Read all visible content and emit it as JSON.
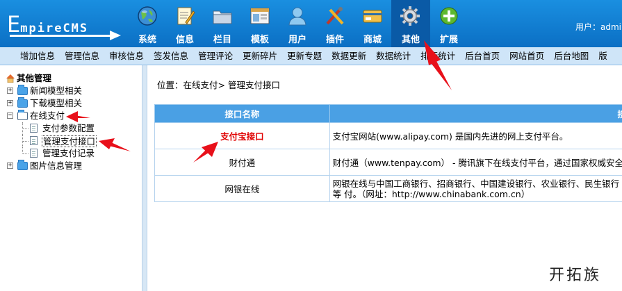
{
  "logo": {
    "first_letter": "E",
    "rest": "mpireCMS"
  },
  "nav": [
    {
      "label": "系统",
      "icon": "globe-icon"
    },
    {
      "label": "信息",
      "icon": "notepad-icon"
    },
    {
      "label": "栏目",
      "icon": "folder-icon"
    },
    {
      "label": "模板",
      "icon": "template-window-icon"
    },
    {
      "label": "用户",
      "icon": "user-icon"
    },
    {
      "label": "插件",
      "icon": "plugin-tools-icon"
    },
    {
      "label": "商城",
      "icon": "shop-card-icon"
    },
    {
      "label": "其他",
      "icon": "gear-icon",
      "active": true
    },
    {
      "label": "扩展",
      "icon": "plus-icon"
    }
  ],
  "user": {
    "label": "用户：",
    "name": "admin"
  },
  "submenu": [
    "增加信息",
    "管理信息",
    "审核信息",
    "签发信息",
    "管理评论",
    "更新碎片",
    "更新专题",
    "数据更新",
    "数据统计",
    "排行统计",
    "后台首页",
    "网站首页",
    "后台地图",
    "版"
  ],
  "tree": {
    "root": "其他管理",
    "nodes": [
      {
        "label": "新闻模型相关",
        "expand": "+"
      },
      {
        "label": "下载模型相关",
        "expand": "+"
      },
      {
        "label": "在线支付",
        "expand": "−",
        "children": [
          "支付参数配置",
          "管理支付接口",
          "管理支付记录"
        ]
      },
      {
        "label": "图片信息管理",
        "expand": "+"
      }
    ]
  },
  "breadcrumb": {
    "prefix": "位置：",
    "parent": "在线支付",
    "sep": "> ",
    "current": "管理支付接口"
  },
  "table": {
    "headers": [
      "接口名称",
      "接"
    ],
    "rows": [
      {
        "name": "支付宝接口",
        "desc": "支付宝网站(www.alipay.com) 是国内先进的网上支付平台。",
        "highlight": true
      },
      {
        "name": "财付通",
        "desc": "财付通（www.tenpay.com） - 腾讯旗下在线支付平台，通过国家权威安全"
      },
      {
        "name": "网银在线",
        "desc": "网银在线与中国工商银行、招商银行、中国建设银行、农业银行、民生银行等 付。（网址：http://www.chinabank.com.cn）"
      }
    ]
  },
  "watermark": "开拓族",
  "colors": {
    "header": "#0b6fc4",
    "submenu": "#cfe5f8",
    "table_header": "#4aa0e4",
    "highlight": "#e00000",
    "annotation": "#e8101a"
  }
}
